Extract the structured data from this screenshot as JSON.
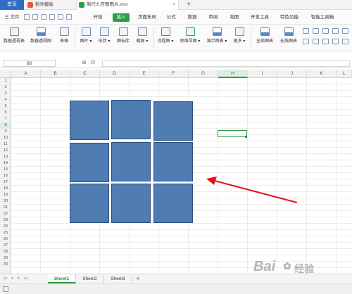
{
  "titlebar": {
    "home_label": "首页",
    "tabs": [
      {
        "label": "稻壳模板",
        "icon": "docer-icon",
        "color": "#e25b3a"
      },
      {
        "label": "制作九宫图图片.xlsx",
        "icon": "sheet-file-icon",
        "color": "#2f9b47"
      }
    ],
    "close_glyph": "×"
  },
  "menubar": {
    "file_label": "三 文件",
    "items": [
      "开始",
      "插入",
      "页面布局",
      "公式",
      "数据",
      "审阅",
      "视图",
      "开发工具",
      "特色功能",
      "智能工具箱"
    ],
    "active_item": "插入"
  },
  "ribbon": {
    "groups": [
      {
        "label": "数据透视表",
        "icon": "pivot-table-icon"
      },
      {
        "label": "数据透视图",
        "icon": "pivot-chart-icon"
      },
      {
        "label": "表格",
        "icon": "table-icon"
      },
      {
        "label": "图片 ▾",
        "icon": "picture-icon"
      },
      {
        "label": "形状 ▾",
        "icon": "shape-icon"
      },
      {
        "label": "图标库",
        "icon": "icon-library-icon"
      },
      {
        "label": "截屏 ▾",
        "icon": "screenshot-icon"
      },
      {
        "label": "流程图 ▾",
        "icon": "flowchart-icon"
      },
      {
        "label": "思维导图 ▾",
        "icon": "mindmap-icon"
      },
      {
        "label": "演示图表 ▾",
        "icon": "demo-chart-icon"
      },
      {
        "label": "更多 ▾",
        "icon": "more-icon"
      },
      {
        "label": "全部图表",
        "icon": "all-charts-icon"
      },
      {
        "label": "在线图表",
        "icon": "online-chart-icon"
      }
    ]
  },
  "formulabar": {
    "cell_ref": "B8",
    "fx_label": "fx"
  },
  "grid": {
    "columns": [
      "A",
      "B",
      "C",
      "D",
      "E",
      "F",
      "G",
      "H",
      "I",
      "J",
      "K",
      "L"
    ],
    "selected_column": "H",
    "rows": [
      "1",
      "2",
      "3",
      "4",
      "5",
      "6",
      "7",
      "8",
      "9",
      "10",
      "11",
      "12",
      "13",
      "14",
      "15",
      "16",
      "17",
      "18",
      "19",
      "20",
      "21",
      "22",
      "23",
      "24",
      "25",
      "26",
      "27",
      "28",
      "29",
      "30"
    ],
    "selected_row": "8",
    "piece_color": "#4e7cb3"
  },
  "annotation": {
    "arrow_color": "#e0141a"
  },
  "sheets": {
    "tabs": [
      "Sheet1",
      "Sheet2",
      "Sheet3"
    ],
    "active": "Sheet1",
    "add_glyph": "+"
  },
  "watermark": {
    "text_main": "Bai",
    "text_sub": "经验"
  }
}
